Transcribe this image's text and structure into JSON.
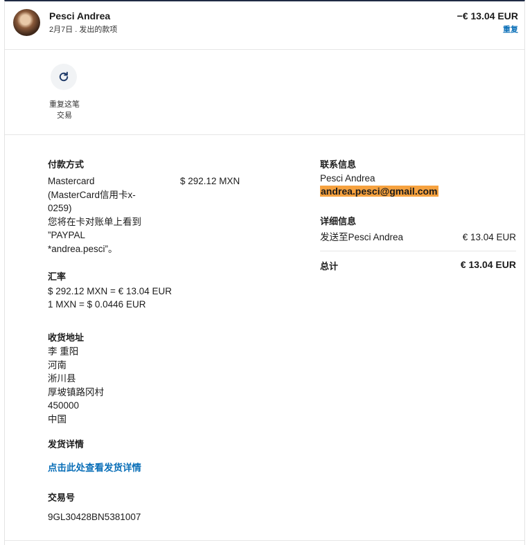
{
  "header": {
    "name": "Pesci Andrea",
    "subtitle": "2月7日 . 发出的款项",
    "amount": "−€ 13.04 EUR",
    "repeat_link": "重复"
  },
  "actions": {
    "repeat_label": "重复这笔\n交易"
  },
  "payment": {
    "heading": "付款方式",
    "method": "Mastercard\n(MasterCard信用卡x-\n0259)\n您将在卡对账单上看到\n”PAYPAL\n*andrea.pesci”。",
    "amount": "$ 292.12 MXN"
  },
  "exchange": {
    "heading": "汇率",
    "line1": "$ 292.12 MXN = € 13.04 EUR",
    "line2": "1 MXN = $ 0.0446 EUR"
  },
  "shipping": {
    "heading": "收货地址",
    "address": "李 重阳\n河南\n淅川县\n厚坡镇路冈村\n450000\n中国"
  },
  "shipping_details": {
    "heading": "发货详情",
    "link": "点击此处查看发货详情"
  },
  "transaction": {
    "heading": "交易号",
    "id": "9GL30428BN5381007"
  },
  "contact": {
    "heading": "联系信息",
    "name": "Pesci Andrea",
    "email": "andrea.pesci@gmail.com"
  },
  "details": {
    "heading": "详细信息",
    "sent_to": "发送至Pesci Andrea",
    "sent_amount": "€ 13.04 EUR",
    "total_label": "总计",
    "total_amount": "€ 13.04 EUR"
  },
  "colors": {
    "accent": "#0a6fb8",
    "highlight": "#f6a23f",
    "top_border": "#1f2a44"
  },
  "icons": {
    "repeat": "refresh-icon",
    "avatar": "avatar"
  }
}
